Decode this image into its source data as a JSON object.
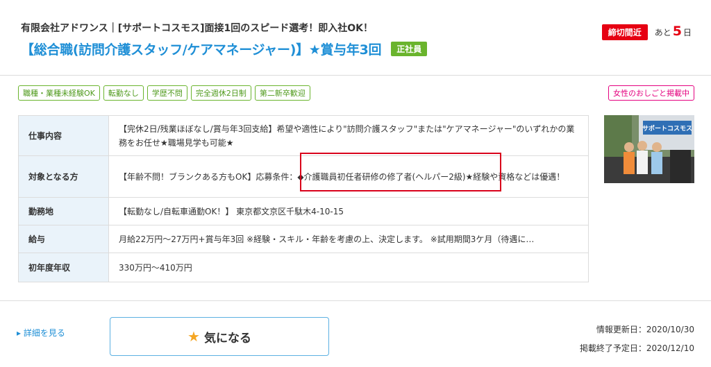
{
  "header": {
    "company": "有限会社アドワンス｜[サポートコスモス]面接1回のスピード選考！即入社OK！",
    "job_title": "【総合職(訪問介護スタッフ/ケアマネージャー)】★賞与年3回",
    "employment_type": "正社員",
    "deadline_badge": "締切間近",
    "deadline_prefix": "あと",
    "deadline_days": "5",
    "deadline_suffix": "日"
  },
  "tags": [
    "職種・業種未経験OK",
    "転勤なし",
    "学歴不問",
    "完全週休2日制",
    "第二新卒歓迎"
  ],
  "women_tag": "女性のおしごと掲載中",
  "details": {
    "job_content_label": "仕事内容",
    "job_content": "【完休2日/残業ほぼなし/賞与年3回支給】希望や適性により\"訪問介護スタッフ\"または\"ケアマネージャー\"のいずれかの業務をお任せ★職場見学も可能★",
    "target_label": "対象となる方",
    "target": "【年齢不問！ブランクある方もOK】応募条件：◆介護職員初任者研修の修了者(ヘルパー2級)★経験や資格などは優遇！",
    "location_label": "勤務地",
    "location": "【転勤なし/自転車通勤OK！】 東京都文京区千駄木4-10-15",
    "salary_label": "給与",
    "salary": "月給22万円～27万円+賞与年3回 ※経験・スキル・年齢を考慮の上、決定します。 ※試用期間3ケ月（待遇に…",
    "income_label": "初年度年収",
    "income": "330万円～410万円"
  },
  "photo": {
    "sign_text": "サポートコスモス"
  },
  "footer": {
    "detail_link": "▸ 詳細を見る",
    "interest_button": "気になる",
    "updated_label": "情報更新日：",
    "updated_date": "2020/10/30",
    "end_label": "掲載終了予定日：",
    "end_date": "2020/12/10"
  },
  "colors": {
    "accent_blue": "#1f8fd6",
    "green": "#6ab42d",
    "red": "#e60012",
    "pink": "#e4007f",
    "star": "#f5a623"
  },
  "icons": [
    "star-icon"
  ]
}
